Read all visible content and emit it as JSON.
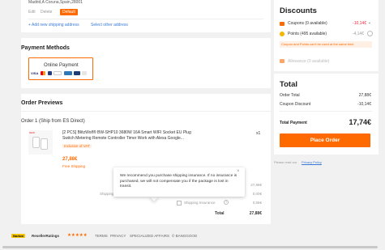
{
  "address": {
    "line": "Madrid,A Coruna,Spain,28001",
    "edit": "Edit",
    "delete": "Delete",
    "default_badge": "Default",
    "add_new": "+ Add new shipping address",
    "select_other": "Select other address"
  },
  "payment": {
    "title": "Payment Methods",
    "option_label": "Online Payment",
    "card_brands": [
      "VISA",
      "mastercard",
      "PayPal",
      "GPay",
      "AMEX",
      "bank",
      "card"
    ]
  },
  "orders": {
    "title": "Order Previews",
    "order_label": "Order 1 (Ship from ES Direct)",
    "product": {
      "thumb_badge": "NEW",
      "title_line1": "[2 PCS] BlitzWolf® BW-SHP10 3680W 16A Smart WIFI Socket EU Plug",
      "title_line2": "Switch Metering Remote Controller Timer Work with Alexa Google...",
      "vat_tag": "Inclusive of VAT",
      "price": "27,88€",
      "shipping": "Free Shipping",
      "qty": "x1"
    },
    "summary": {
      "subtotal_value": "27,88€",
      "shipping_label": "Shipping",
      "shipping_value": "0,00€",
      "insurance_label": "Shipping Insurance",
      "insurance_value": "0,56€",
      "total_label": "Total",
      "total_value": "27,88€"
    },
    "tooltip": "We recommend you purchase shipping insurance. If no insurance is purchased, we will not compensate you if the package is lost in transit."
  },
  "discounts": {
    "title": "Discounts",
    "coupons_label": "Coupons (0 available)",
    "coupons_value": "-10,14€",
    "points_label": "Points (495 available)",
    "points_value": "-4,14€",
    "warning": "Coupon and Points can't be used at the same time",
    "allowance_label": "Allowance (0 available)"
  },
  "total": {
    "title": "Total",
    "order_total_label": "Order Total",
    "order_total_value": "27,88€",
    "coupon_discount_label": "Coupon Discount",
    "coupon_discount_value": "-10,14€",
    "total_payment_label": "Total Payment",
    "total_payment_value": "17,74€",
    "place_order": "Place Order",
    "privacy_prefix": "Please read our",
    "privacy_link": "Privacy Policy"
  },
  "footer": {
    "norton": "Norton",
    "reseller": "ResellerRatings",
    "stars": "★★★★★",
    "links": [
      "TERMS",
      "PRIVACY",
      "SPECIALIZED AFFAIRS"
    ],
    "copyright": "© BANGGOOD"
  },
  "colors": {
    "accent": "#ff6a00",
    "link": "#3a7bd5",
    "page_bg": "#f1f1f1"
  },
  "icons": [
    "coupon-icon",
    "points-icon",
    "allowance-icon",
    "chevron-down-icon",
    "close-icon",
    "help-icon"
  ]
}
